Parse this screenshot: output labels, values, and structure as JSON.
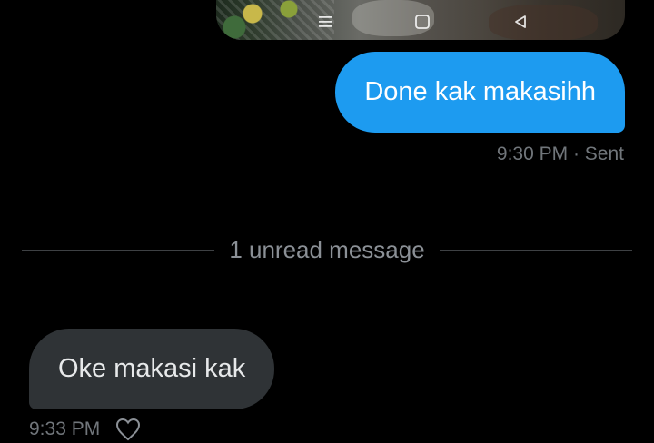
{
  "media_attachment": {
    "navbar_icons": [
      "menu-icon",
      "home-square-icon",
      "back-triangle-icon"
    ]
  },
  "sent_message": {
    "text": "Done kak makasihh",
    "meta": "9:30 PM · Sent",
    "bubble_color": "#1d9bf0"
  },
  "unread_divider": {
    "label": "1 unread message"
  },
  "received_message": {
    "text": "Oke makasi kak",
    "time": "9:33 PM",
    "bubble_color": "#2f3336",
    "reaction_icon": "heart-outline-icon"
  },
  "colors": {
    "background": "#000000",
    "secondary_text": "#71767b",
    "divider": "#3e4144"
  }
}
